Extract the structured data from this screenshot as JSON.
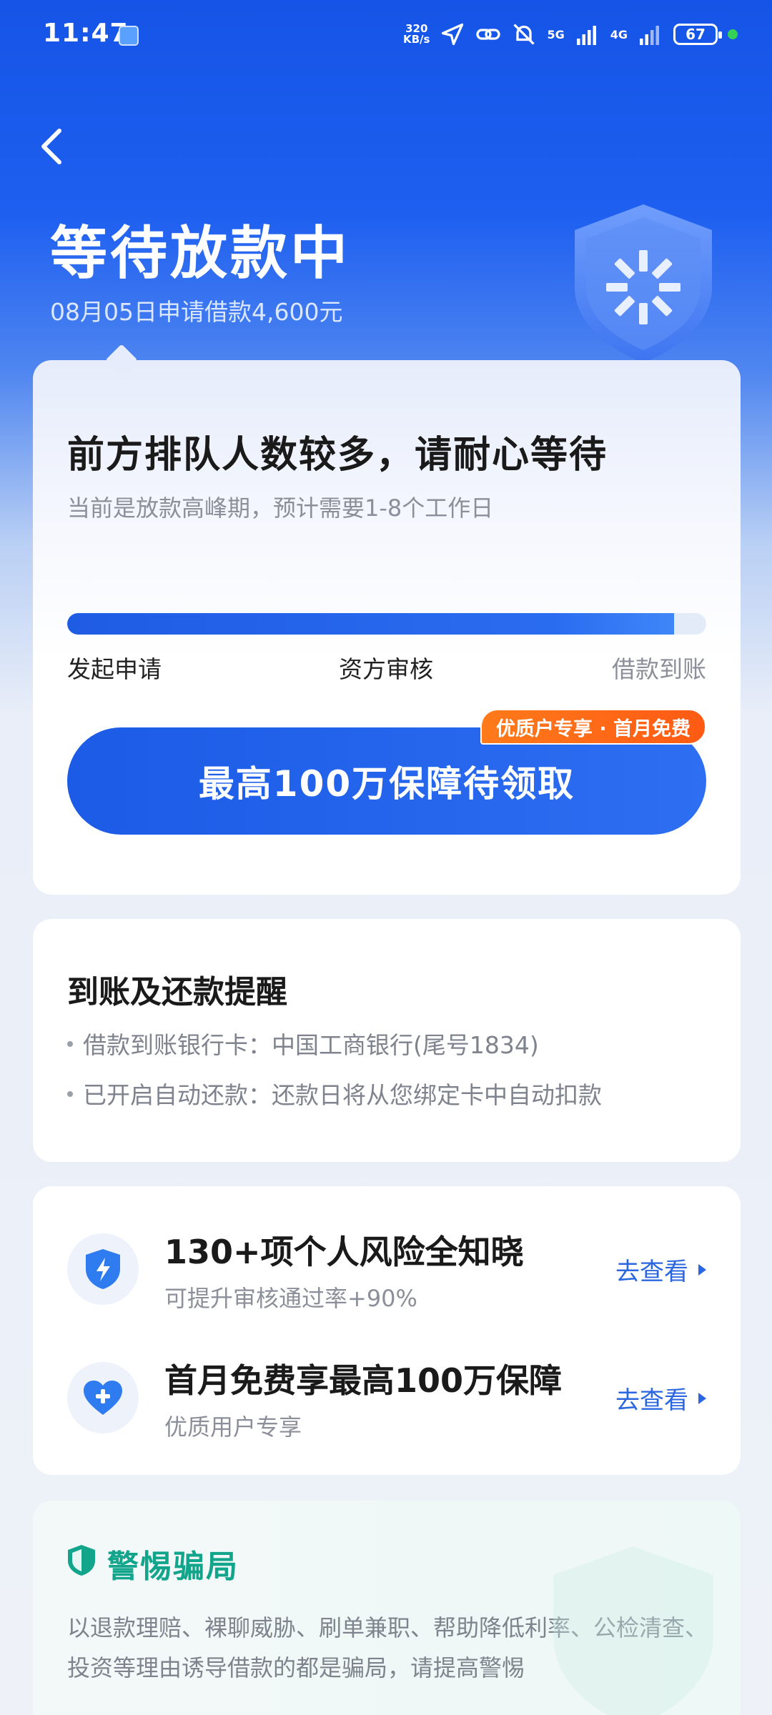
{
  "status_bar": {
    "time": "11:47",
    "net_speed_value": "320",
    "net_speed_unit": "KB/s",
    "signal_1": "5G",
    "signal_2": "4G",
    "battery": "67"
  },
  "header": {
    "title": "等待放款中",
    "subtitle": "08月05日申请借款4,600元"
  },
  "status_card": {
    "heading": "前方排队人数较多，请耐心等待",
    "description": "当前是放款高峰期，预计需要1-8个工作日",
    "progress": 0.95,
    "steps": [
      "发起申请",
      "资方审核",
      "借款到账"
    ],
    "cta_label": "最高100万保障待领取",
    "cta_badge": "优质户专享 · 首月免费"
  },
  "reminder_card": {
    "title": "到账及还款提醒",
    "items": [
      "借款到账银行卡：中国工商银行(尾号1834)",
      "已开启自动还款：还款日将从您绑定卡中自动扣款"
    ]
  },
  "offers": [
    {
      "icon": "shield-lightning-icon",
      "title": "130+项个人风险全知晓",
      "subtitle": "可提升审核通过率+90%",
      "link": "去查看"
    },
    {
      "icon": "heart-plus-icon",
      "title": "首月免费享最高100万保障",
      "subtitle": "优质用户专享",
      "link": "去查看"
    }
  ],
  "warning_card": {
    "title": "警惕骗局",
    "text": "以退款理赔、裸聊威胁、刷单兼职、帮助降低利率、公检清查、投资等理由诱导借款的都是骗局，请提高警惕"
  },
  "colors": {
    "brand_blue": "#1b5be6",
    "warning_green": "#12a58c",
    "badge_orange": "#ff6a16"
  }
}
